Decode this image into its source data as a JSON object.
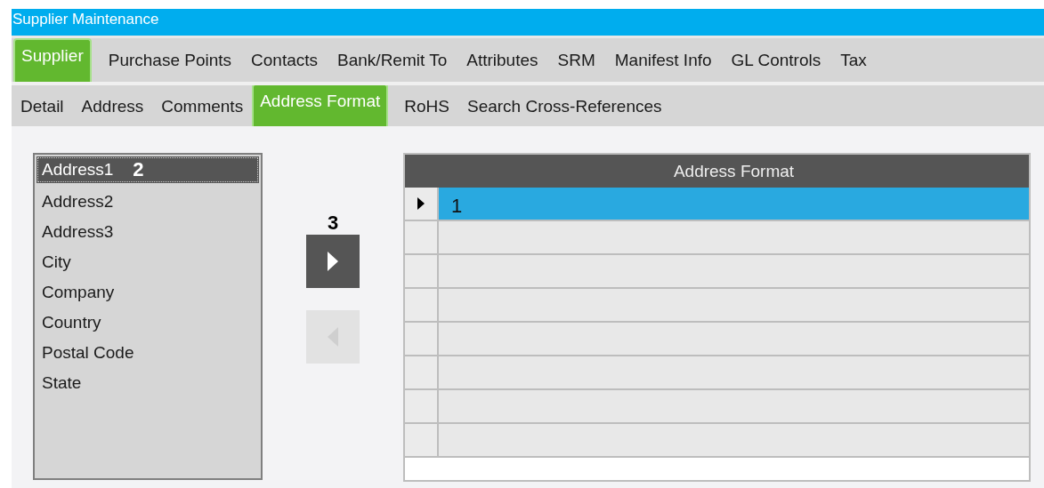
{
  "window": {
    "title": "Supplier Maintenance"
  },
  "tabs": [
    {
      "label": "Supplier",
      "selected": true
    },
    {
      "label": "Purchase Points",
      "selected": false
    },
    {
      "label": "Contacts",
      "selected": false
    },
    {
      "label": "Bank/Remit To",
      "selected": false
    },
    {
      "label": "Attributes",
      "selected": false
    },
    {
      "label": "SRM",
      "selected": false
    },
    {
      "label": "Manifest Info",
      "selected": false
    },
    {
      "label": "GL Controls",
      "selected": false
    },
    {
      "label": "Tax",
      "selected": false
    }
  ],
  "subtabs": [
    {
      "label": "Detail",
      "selected": false
    },
    {
      "label": "Address",
      "selected": false
    },
    {
      "label": "Comments",
      "selected": false
    },
    {
      "label": "Address Format",
      "selected": true
    },
    {
      "label": "RoHS",
      "selected": false
    },
    {
      "label": "Search Cross-References",
      "selected": false
    }
  ],
  "field_list": {
    "items": [
      {
        "label": "Address1",
        "selected": true,
        "callout": "2"
      },
      {
        "label": "Address2",
        "selected": false
      },
      {
        "label": "Address3",
        "selected": false
      },
      {
        "label": "City",
        "selected": false
      },
      {
        "label": "Company",
        "selected": false
      },
      {
        "label": "Country",
        "selected": false
      },
      {
        "label": "Postal Code",
        "selected": false
      },
      {
        "label": "State",
        "selected": false
      }
    ]
  },
  "move_buttons": {
    "callout": "3",
    "add": {
      "disabled": false
    },
    "remove": {
      "disabled": true
    }
  },
  "grid": {
    "columns": [
      "Address Format"
    ],
    "rows": [
      {
        "cells": [
          "1"
        ],
        "selected": true
      },
      {
        "cells": [
          ""
        ],
        "selected": false
      },
      {
        "cells": [
          ""
        ],
        "selected": false
      },
      {
        "cells": [
          ""
        ],
        "selected": false
      },
      {
        "cells": [
          ""
        ],
        "selected": false
      },
      {
        "cells": [
          ""
        ],
        "selected": false
      },
      {
        "cells": [
          ""
        ],
        "selected": false
      },
      {
        "cells": [
          ""
        ],
        "selected": false
      }
    ]
  }
}
